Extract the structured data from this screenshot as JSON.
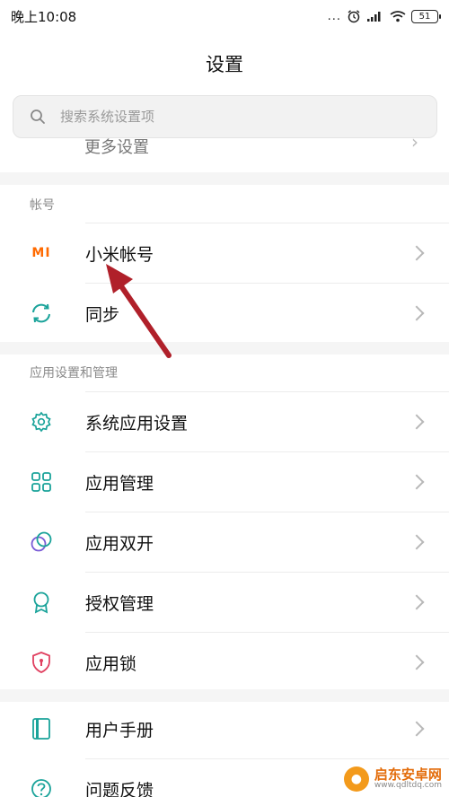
{
  "status_bar": {
    "time": "晚上10:08",
    "dots": "...",
    "battery": "51"
  },
  "page_title": "设置",
  "search": {
    "placeholder": "搜索系统设置项"
  },
  "partial_row": {
    "label": "更多设置"
  },
  "sections": [
    {
      "title": "帐号",
      "items": [
        {
          "label": "小米帐号",
          "icon": "mi-logo-icon"
        },
        {
          "label": "同步",
          "icon": "sync-icon"
        }
      ]
    },
    {
      "title": "应用设置和管理",
      "items": [
        {
          "label": "系统应用设置",
          "icon": "gear-icon"
        },
        {
          "label": "应用管理",
          "icon": "grid-icon"
        },
        {
          "label": "应用双开",
          "icon": "dual-circle-icon"
        },
        {
          "label": "授权管理",
          "icon": "badge-icon"
        },
        {
          "label": "应用锁",
          "icon": "shield-lock-icon"
        }
      ]
    },
    {
      "title": "",
      "items": [
        {
          "label": "用户手册",
          "icon": "book-icon"
        },
        {
          "label": "问题反馈",
          "icon": "question-icon"
        }
      ]
    }
  ],
  "mi_logo_text": "MI",
  "watermark": {
    "title": "启东安卓网",
    "url": "www.qdltdq.com"
  },
  "colors": {
    "accent_teal": "#1aa39a",
    "mi_orange": "#ff6a00",
    "arrow_red": "#b0202a",
    "section_bg": "#f5f5f5"
  }
}
